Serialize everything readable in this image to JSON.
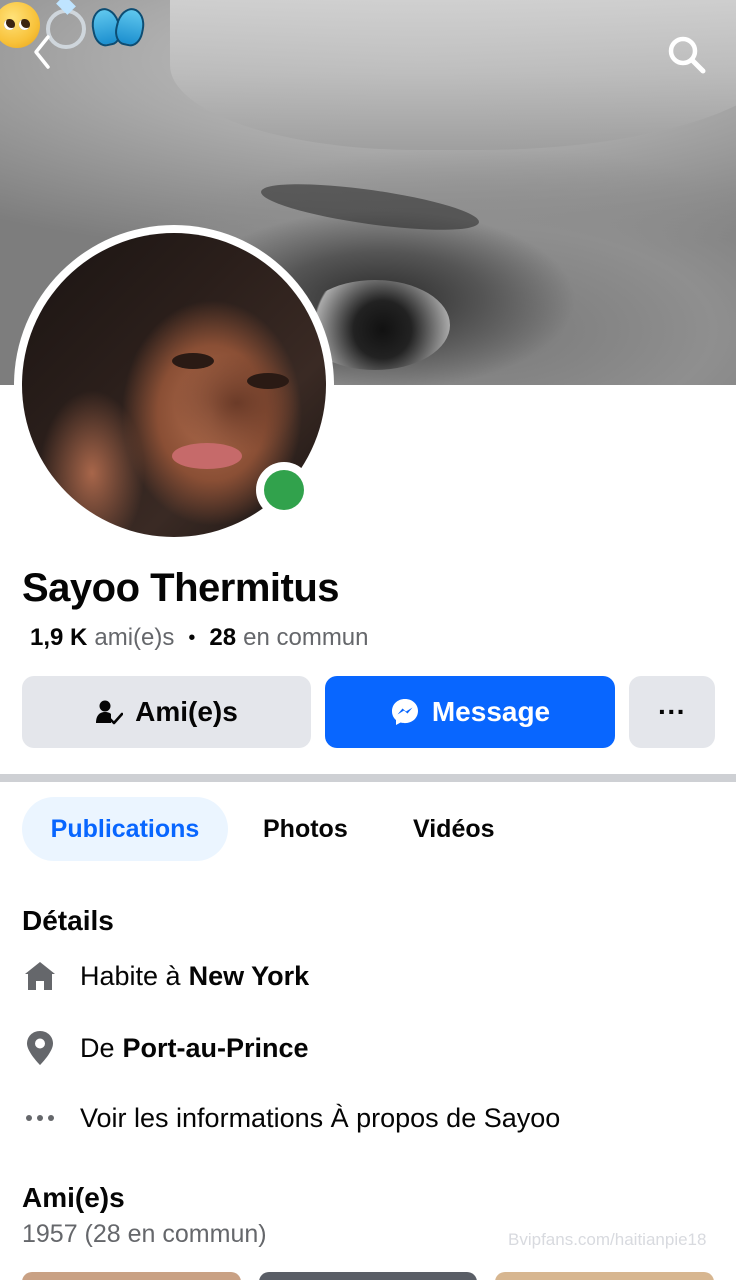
{
  "header": {
    "back_icon": "chevron-left-icon",
    "search_icon": "search-icon",
    "cover_emojis": [
      "pleading-face",
      "ring",
      "butterfly"
    ]
  },
  "profile": {
    "name": "Sayoo Thermitus",
    "online": true,
    "friends_count": "1,9 K",
    "friends_label": "ami(e)s",
    "separator": "•",
    "mutual_count": "28",
    "mutual_label": "en commun"
  },
  "actions": {
    "friends_label": "Ami(e)s",
    "message_label": "Message",
    "more_label": "···"
  },
  "tabs": [
    {
      "label": "Publications",
      "active": true
    },
    {
      "label": "Photos",
      "active": false
    },
    {
      "label": "Vidéos",
      "active": false
    }
  ],
  "details": {
    "title": "Détails",
    "lives_prefix": "Habite à",
    "lives_city": "New York",
    "from_prefix": "De",
    "from_city": "Port-au-Prince",
    "about_text": "Voir les informations À propos de Sayoo"
  },
  "friends": {
    "title": "Ami(e)s",
    "subtitle": "1957 (28 en commun)"
  },
  "watermark": "Bvipfans.com/haitianpie18",
  "colors": {
    "accent": "#0866ff",
    "online": "#31a24c",
    "secondary_text": "#65676b",
    "button_gray": "#e4e6eb"
  }
}
